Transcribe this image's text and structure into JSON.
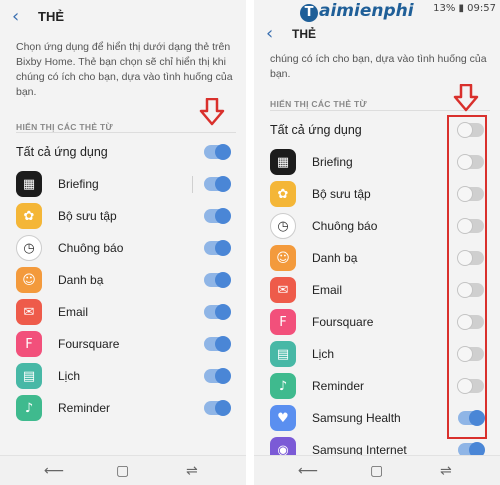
{
  "left": {
    "title": "THẺ",
    "description": "Chọn ứng dụng để hiển thị dưới dạng thẻ trên Bixby Home. Thẻ bạn chọn sẽ chỉ hiển thị khi chúng có ích cho bạn, dựa vào tình huống của bạn.",
    "section_label": "HIỂN THỊ CÁC THẺ TỪ",
    "all_apps_label": "Tất cả ứng dụng",
    "all_apps_on": true,
    "apps": [
      {
        "name": "Briefing",
        "icon": "briefing-icon",
        "color": "#1c1c1c",
        "glyph": "▦",
        "on": true
      },
      {
        "name": "Bộ sưu tập",
        "icon": "gallery-icon",
        "color": "#f4b637",
        "glyph": "✿",
        "on": true
      },
      {
        "name": "Chuông báo",
        "icon": "alarm-icon",
        "color": "#ffffff",
        "glyph": "◷",
        "on": true
      },
      {
        "name": "Danh bạ",
        "icon": "contacts-icon",
        "color": "#f39a3c",
        "glyph": "☺",
        "on": true
      },
      {
        "name": "Email",
        "icon": "email-icon",
        "color": "#ee5b4a",
        "glyph": "✉",
        "on": true
      },
      {
        "name": "Foursquare",
        "icon": "foursquare-icon",
        "color": "#f2507b",
        "glyph": "F",
        "on": true
      },
      {
        "name": "Lịch",
        "icon": "calendar-icon",
        "color": "#47b8a6",
        "glyph": "▤",
        "on": true
      },
      {
        "name": "Reminder",
        "icon": "reminder-icon",
        "color": "#3fba8e",
        "glyph": "♪",
        "on": true
      }
    ]
  },
  "right": {
    "watermark": "aimienphi",
    "watermark_initial": "T",
    "status_text": "13% ▮ 09:57",
    "title": "THẺ",
    "description": "chúng có ích cho bạn, dựa vào tình huống của bạn.",
    "section_label": "HIỂN THỊ CÁC THẺ TỪ",
    "all_apps_label": "Tất cả ứng dụng",
    "all_apps_on": false,
    "apps": [
      {
        "name": "Briefing",
        "icon": "briefing-icon",
        "color": "#1c1c1c",
        "glyph": "▦",
        "on": false
      },
      {
        "name": "Bộ sưu tập",
        "icon": "gallery-icon",
        "color": "#f4b637",
        "glyph": "✿",
        "on": false
      },
      {
        "name": "Chuông báo",
        "icon": "alarm-icon",
        "color": "#ffffff",
        "glyph": "◷",
        "on": false
      },
      {
        "name": "Danh bạ",
        "icon": "contacts-icon",
        "color": "#f39a3c",
        "glyph": "☺",
        "on": false
      },
      {
        "name": "Email",
        "icon": "email-icon",
        "color": "#ee5b4a",
        "glyph": "✉",
        "on": false
      },
      {
        "name": "Foursquare",
        "icon": "foursquare-icon",
        "color": "#f2507b",
        "glyph": "F",
        "on": false
      },
      {
        "name": "Lịch",
        "icon": "calendar-icon",
        "color": "#47b8a6",
        "glyph": "▤",
        "on": false
      },
      {
        "name": "Reminder",
        "icon": "reminder-icon",
        "color": "#3fba8e",
        "glyph": "♪",
        "on": false
      },
      {
        "name": "Samsung Health",
        "icon": "samsung-health-icon",
        "color": "#5a8ff0",
        "glyph": "♥",
        "on": true
      },
      {
        "name": "Samsung Internet",
        "icon": "samsung-internet-icon",
        "color": "#7b5ad6",
        "glyph": "◉",
        "on": true
      }
    ]
  },
  "colors": {
    "accent": "#4a86d6",
    "highlight": "#d9302c"
  },
  "nav": {
    "back": "⟵",
    "home": "▢",
    "recent": "⇌"
  }
}
